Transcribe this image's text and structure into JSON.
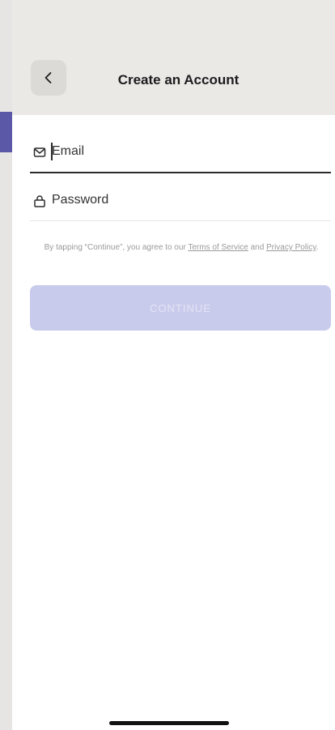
{
  "header": {
    "title": "Create an Account",
    "back_icon": "chevron-left-icon"
  },
  "form": {
    "email": {
      "placeholder": "Email",
      "icon": "mail-icon"
    },
    "password": {
      "placeholder": "Password",
      "icon": "lock-icon"
    },
    "terms": {
      "prefix": "By tapping “Continue”, you agree to our ",
      "terms_link": "Terms of Service",
      "middle": " and ",
      "privacy_link": "Privacy Policy",
      "suffix": "."
    },
    "continue_label": "CONTINUE"
  },
  "colors": {
    "header_bg": "#ebe9e6",
    "accent": "#5a58a7",
    "button_disabled": "#c9cbec"
  }
}
